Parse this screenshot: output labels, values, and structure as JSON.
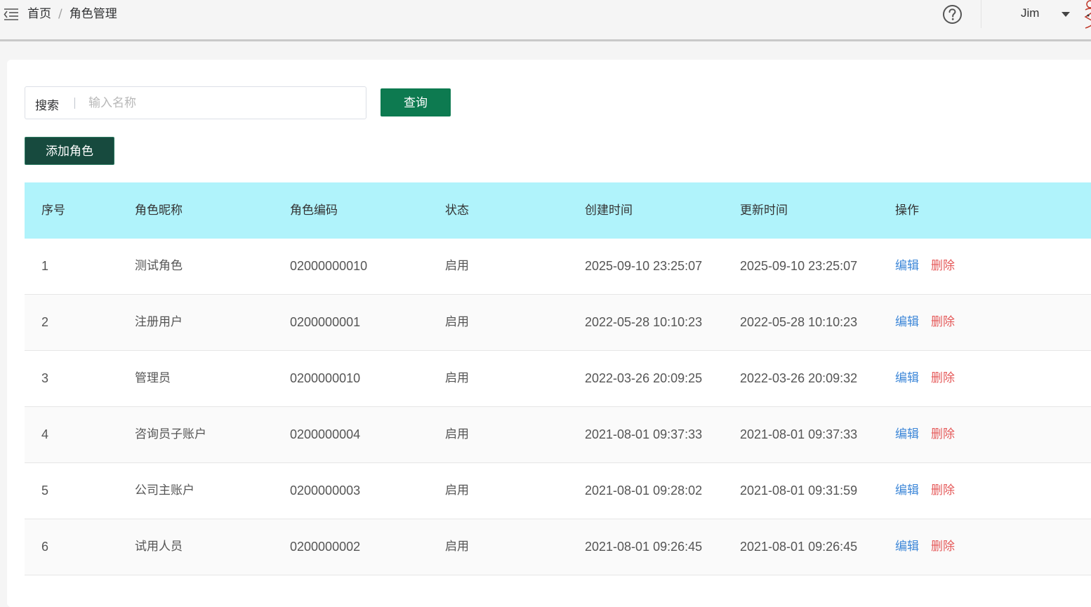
{
  "header": {
    "breadcrumb": [
      "首页",
      "角色管理"
    ],
    "breadcrumb_separator": "/",
    "user_name": "Jim",
    "icons": {
      "menu_toggle": "menu-fold-icon",
      "help": "question-circle-icon",
      "caret": "caret-down-icon"
    }
  },
  "search": {
    "label": "搜索",
    "placeholder": "输入名称",
    "value": ""
  },
  "buttons": {
    "query_label": "查询",
    "add_label": "添加角色"
  },
  "table": {
    "columns": [
      "序号",
      "角色昵称",
      "角色编码",
      "状态",
      "创建时间",
      "更新时间",
      "操作"
    ],
    "rows": [
      {
        "index": "1",
        "nickname": "测试角色",
        "code": "02000000010",
        "status": "启用",
        "created": "2025-09-10 23:25:07",
        "updated": "2025-09-10 23:25:07"
      },
      {
        "index": "2",
        "nickname": "注册用户",
        "code": "0200000001",
        "status": "启用",
        "created": "2022-05-28 10:10:23",
        "updated": "2022-05-28 10:10:23"
      },
      {
        "index": "3",
        "nickname": "管理员",
        "code": "0200000010",
        "status": "启用",
        "created": "2022-03-26 20:09:25",
        "updated": "2022-03-26 20:09:32"
      },
      {
        "index": "4",
        "nickname": "咨询员子账户",
        "code": "0200000004",
        "status": "启用",
        "created": "2021-08-01 09:37:33",
        "updated": "2021-08-01 09:37:33"
      },
      {
        "index": "5",
        "nickname": "公司主账户",
        "code": "0200000003",
        "status": "启用",
        "created": "2021-08-01 09:28:02",
        "updated": "2021-08-01 09:31:59"
      },
      {
        "index": "6",
        "nickname": "试用人员",
        "code": "0200000002",
        "status": "启用",
        "created": "2021-08-01 09:26:45",
        "updated": "2021-08-01 09:26:45"
      }
    ],
    "actions": {
      "edit": "编辑",
      "delete": "删除"
    }
  },
  "colors": {
    "primary_button": "#0d7a50",
    "add_button": "#174a3e",
    "table_header": "#b0f3fb",
    "edit_link": "#3d87d8",
    "delete_link": "#e55a5a"
  }
}
